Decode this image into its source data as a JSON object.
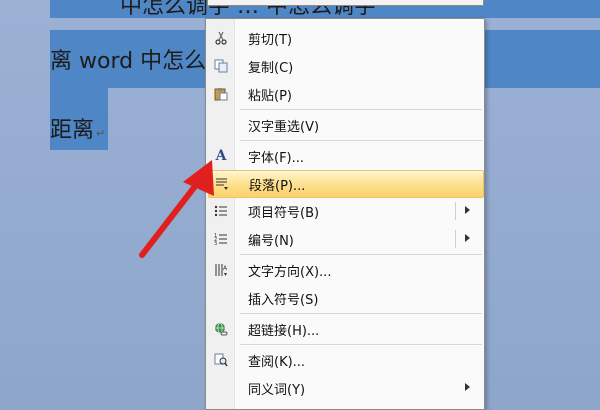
{
  "document": {
    "line1": "中怎么调字  …  中怎么调字",
    "line2": "离 word 中怎么 …    d 中怎么调字",
    "line3": "距离"
  },
  "context_menu": {
    "items": [
      {
        "label": "剪切(T)",
        "icon": "scissors-icon"
      },
      {
        "label": "复制(C)",
        "icon": "copy-icon"
      },
      {
        "label": "粘贴(P)",
        "icon": "paste-icon"
      },
      {
        "label": "汉字重选(V)",
        "icon": ""
      },
      {
        "label": "字体(F)...",
        "icon": "font-icon",
        "glyph": "A"
      },
      {
        "label": "段落(P)...",
        "icon": "paragraph-icon",
        "highlighted": true
      },
      {
        "label": "项目符号(B)",
        "icon": "bullets-icon",
        "submenu": true
      },
      {
        "label": "编号(N)",
        "icon": "numbering-icon",
        "submenu": true
      },
      {
        "label": "文字方向(X)...",
        "icon": "text-direction-icon"
      },
      {
        "label": "插入符号(S)",
        "icon": ""
      },
      {
        "label": "超链接(H)...",
        "icon": "hyperlink-icon"
      },
      {
        "label": "查阅(K)...",
        "icon": "lookup-icon"
      },
      {
        "label": "同义词(Y)",
        "icon": "",
        "submenu": true
      }
    ]
  },
  "colors": {
    "selection": "#4f86c6",
    "highlight": "#fde08f",
    "annotation_arrow": "#e0201e"
  }
}
